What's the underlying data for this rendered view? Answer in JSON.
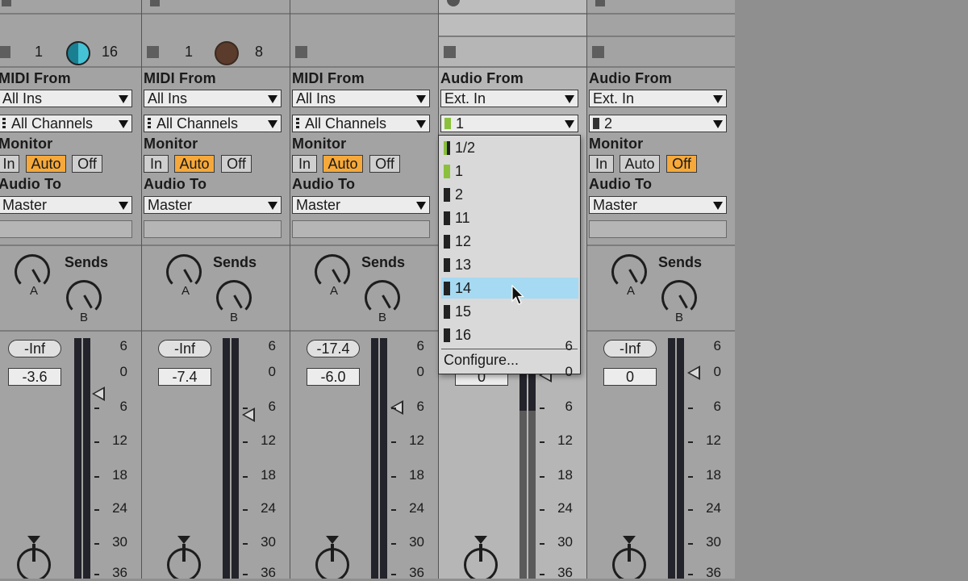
{
  "strips": [
    {
      "input_header": "MIDI From",
      "input_type": "All Ins",
      "channel": "All Channels",
      "monitor_label": "Monitor",
      "monitor": [
        "In",
        "Auto",
        "Off"
      ],
      "monitor_active": "Auto",
      "output_label": "Audio To",
      "output": "Master",
      "sends_label": "Sends",
      "send_a": "A",
      "send_b": "B",
      "peak": "-Inf",
      "volume": "-3.6",
      "ch_lo": "1",
      "ch_hi": "16",
      "knob_color": "#2fa8bf"
    },
    {
      "input_header": "MIDI From",
      "input_type": "All Ins",
      "channel": "All Channels",
      "monitor_label": "Monitor",
      "monitor": [
        "In",
        "Auto",
        "Off"
      ],
      "monitor_active": "Auto",
      "output_label": "Audio To",
      "output": "Master",
      "sends_label": "Sends",
      "send_a": "A",
      "send_b": "B",
      "peak": "-Inf",
      "volume": "-7.4",
      "ch_lo": "1",
      "ch_hi": "8",
      "knob_color": "#5b3b2c"
    },
    {
      "input_header": "MIDI From",
      "input_type": "All Ins",
      "channel": "All Channels",
      "monitor_label": "Monitor",
      "monitor": [
        "In",
        "Auto",
        "Off"
      ],
      "monitor_active": "Auto",
      "output_label": "Audio To",
      "output": "Master",
      "sends_label": "Sends",
      "send_a": "A",
      "send_b": "B",
      "peak": "-17.4",
      "volume": "-6.0"
    },
    {
      "input_header": "Audio From",
      "input_type": "Ext. In",
      "channel": "1",
      "volume": "0",
      "sends_label": "",
      "send_a": "",
      "send_b": ""
    },
    {
      "input_header": "Audio From",
      "input_type": "Ext. In",
      "channel": "2",
      "monitor_label": "Monitor",
      "monitor": [
        "In",
        "Auto",
        "Off"
      ],
      "monitor_active": "Off",
      "output_label": "Audio To",
      "output": "Master",
      "sends_label": "Sends",
      "send_a": "A",
      "send_b": "B",
      "peak": "-Inf",
      "volume": "0"
    }
  ],
  "meter_scale": [
    "6",
    "0",
    "6",
    "12",
    "18",
    "24",
    "30",
    "36"
  ],
  "popup": {
    "items": [
      "1/2",
      "1",
      "2",
      "11",
      "12",
      "13",
      "14",
      "15",
      "16"
    ],
    "highlighted": "14",
    "configure": "Configure..."
  }
}
